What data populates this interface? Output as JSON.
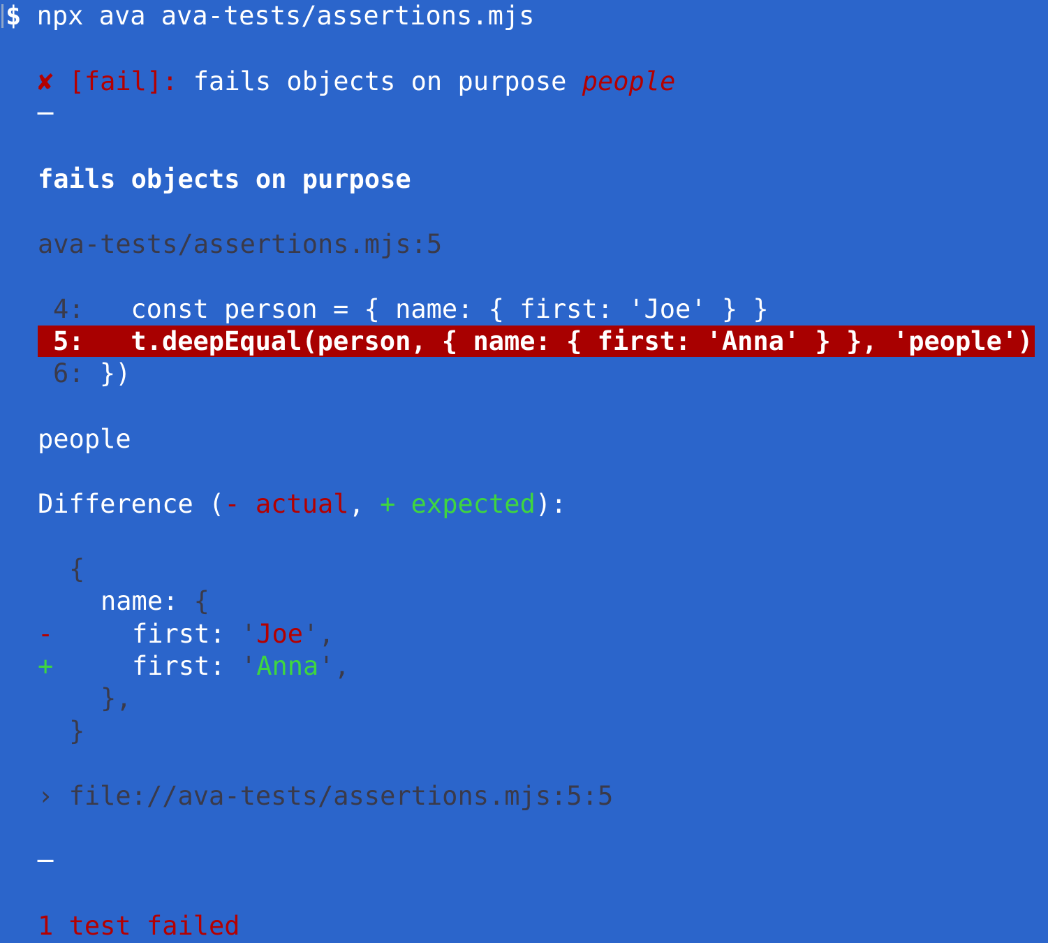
{
  "prompt": {
    "symbol": "$",
    "command": "npx ava ava-tests/assertions.mjs"
  },
  "fail_header": {
    "icon": "✘",
    "tag": "[fail]:",
    "title": "fails objects on purpose",
    "message": "people"
  },
  "separator": "─",
  "test_title": "fails objects on purpose",
  "source_location": "ava-tests/assertions.mjs:5",
  "code_lines": [
    {
      "num": "4:",
      "code": "  const person = { name: { first: 'Joe' } }"
    },
    {
      "num": "5:",
      "code": "  t.deepEqual(person, { name: { first: 'Anna' } }, 'people')"
    },
    {
      "num": "6:",
      "code": "})"
    }
  ],
  "assertion_message": "people",
  "difference": {
    "label": "Difference (",
    "minus": "-",
    "actual": "actual",
    "comma": ",",
    "plus": "+",
    "expected": "expected",
    "close": "):"
  },
  "diff_lines": {
    "open": "{",
    "name_key": "name:",
    "name_open": "{",
    "removed_marker": "-",
    "removed_key": "first:",
    "removed_value": "Joe",
    "added_marker": "+",
    "added_key": "first:",
    "added_value": "Anna",
    "inner_close": "},",
    "outer_close": "}"
  },
  "stack": {
    "arrow": "›",
    "location": "file://ava-tests/assertions.mjs:5:5"
  },
  "summary": "1 test failed",
  "colors": {
    "background": "#2B65CB",
    "error_red": "#B40000",
    "highlight_red": "#A80000",
    "expected_green": "#3FD63F",
    "dim_text": "#3A3A4A"
  }
}
